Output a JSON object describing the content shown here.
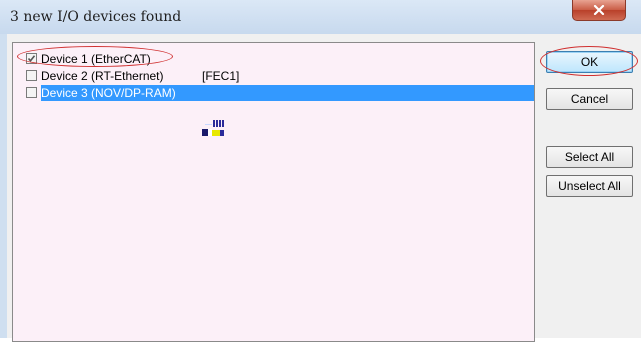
{
  "window": {
    "title": "3 new I/O devices found",
    "close_glyph": "x"
  },
  "devices": [
    {
      "label": "Device 1 (EtherCAT)",
      "extra": "",
      "checked": true,
      "selected": false
    },
    {
      "label": "Device 2 (RT-Ethernet)",
      "extra": "[FEC1]",
      "checked": false,
      "selected": false
    },
    {
      "label": "Device 3 (NOV/DP-RAM)",
      "extra": "",
      "checked": false,
      "selected": true
    }
  ],
  "buttons": {
    "ok_label": "OK",
    "cancel_label": "Cancel",
    "select_all_label": "Select All",
    "unselect_all_label": "Unselect All"
  },
  "colors": {
    "selection": "#3399ff",
    "list_background": "#fcf0f8",
    "annotation": "#d03030",
    "close_button": "#c95c45"
  },
  "icons": {
    "close": "close-icon",
    "checkbox_checked": "checkmark-icon"
  }
}
